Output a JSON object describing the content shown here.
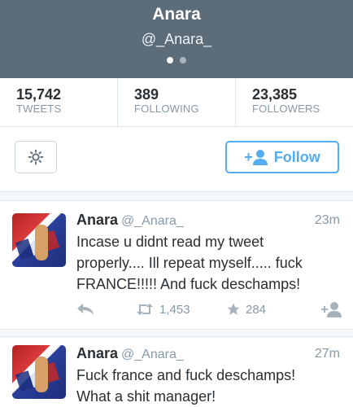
{
  "profile": {
    "name": "Anara",
    "handle": "@_Anara_",
    "page_dots": 2,
    "active_dot": 0
  },
  "stats": [
    {
      "value": "15,742",
      "label": "TWEETS"
    },
    {
      "value": "389",
      "label": "FOLLOWING"
    },
    {
      "value": "23,385",
      "label": "FOLLOWERS"
    }
  ],
  "actions": {
    "settings_icon": "gear-icon",
    "follow_label": "Follow",
    "follow_icon": "add-user-icon",
    "accent": "#55acee"
  },
  "tweets": [
    {
      "name": "Anara",
      "handle": "@_Anara_",
      "time": "23m",
      "lines": [
        "Incase u didnt read my tweet",
        "properly.... Ill repeat myself..... fuck",
        "FRANCE!!!!! And fuck deschamps!"
      ],
      "retweets": "1,453",
      "favorites": "284"
    },
    {
      "name": "Anara",
      "handle": "@_Anara_",
      "time": "27m",
      "lines": [
        "Fuck france and fuck deschamps!",
        "What a shit manager!"
      ]
    }
  ]
}
